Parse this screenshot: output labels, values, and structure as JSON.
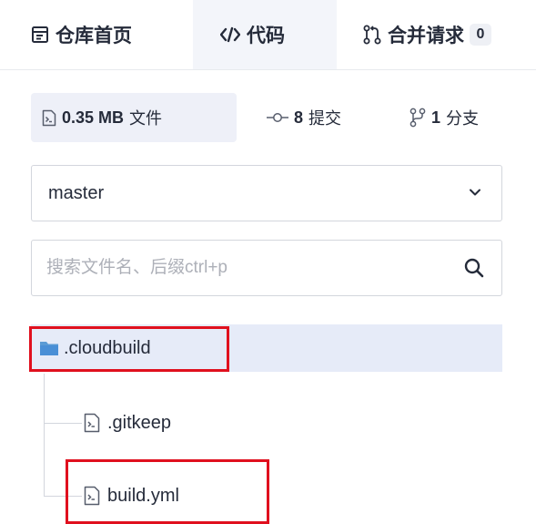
{
  "tabs": {
    "home_label": "仓库首页",
    "code_label": "代码",
    "merge_label": "合并请求",
    "merge_count": "0"
  },
  "stats": {
    "size_value": "0.35 MB",
    "size_label": "文件",
    "commits_value": "8",
    "commits_label": "提交",
    "branches_value": "1",
    "branches_label": "分支"
  },
  "branch_select": {
    "value": "master"
  },
  "search": {
    "placeholder": "搜索文件名、后缀ctrl+p",
    "value": ""
  },
  "tree": {
    "folder": {
      "name": ".cloudbuild",
      "icon": "folder-icon",
      "color": "#5b9bd5"
    },
    "files": [
      {
        "name": ".gitkeep",
        "icon": "file-icon"
      },
      {
        "name": "build.yml",
        "icon": "file-icon"
      }
    ]
  },
  "colors": {
    "highlight": "#e0101e",
    "selected_row": "#e6ebf8",
    "active_tab": "#f3f5fa"
  }
}
